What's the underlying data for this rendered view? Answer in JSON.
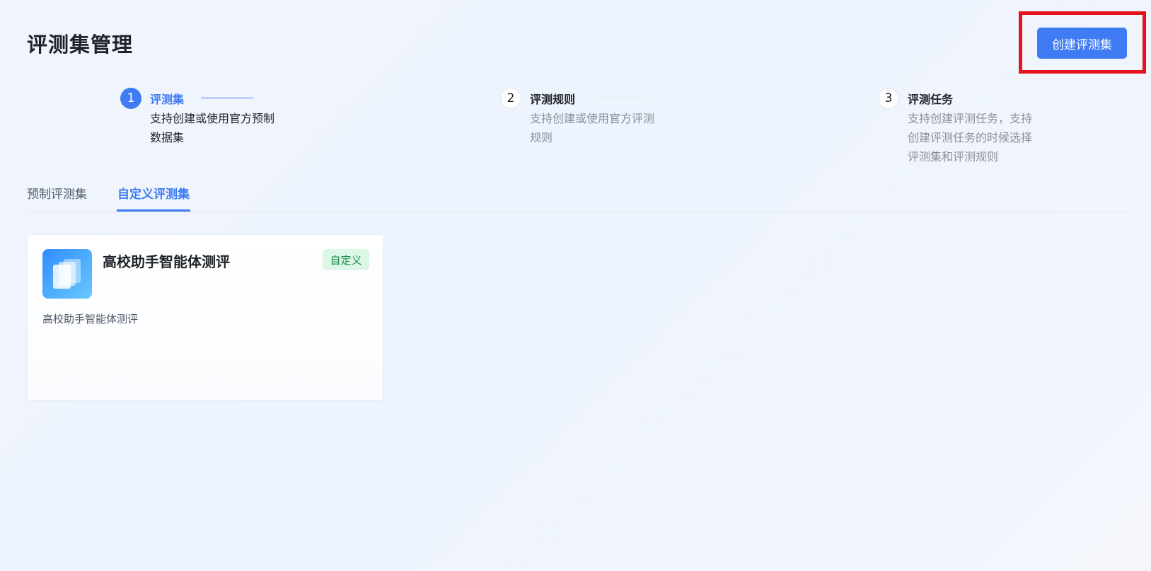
{
  "header": {
    "title": "评测集管理",
    "create_button_label": "创建评测集"
  },
  "steps": [
    {
      "number": "1",
      "title": "评测集",
      "description": "支持创建或使用官方预制数据集"
    },
    {
      "number": "2",
      "title": "评测规则",
      "description": "支持创建或使用官方评测规则"
    },
    {
      "number": "3",
      "title": "评测任务",
      "description": "支持创建评测任务，支持创建评测任务的时候选择评测集和评测规则"
    }
  ],
  "tabs": [
    {
      "label": "预制评测集"
    },
    {
      "label": "自定义评测集"
    }
  ],
  "cards": [
    {
      "title": "高校助手智能体测评",
      "badge": "自定义",
      "description": "高校助手智能体测评",
      "icon": "stacked-documents-icon"
    }
  ],
  "colors": {
    "primary": "#3f7cf4",
    "highlight": "#e6131f",
    "badge_bg": "#ddf7e6",
    "badge_text": "#1f8b4c"
  }
}
